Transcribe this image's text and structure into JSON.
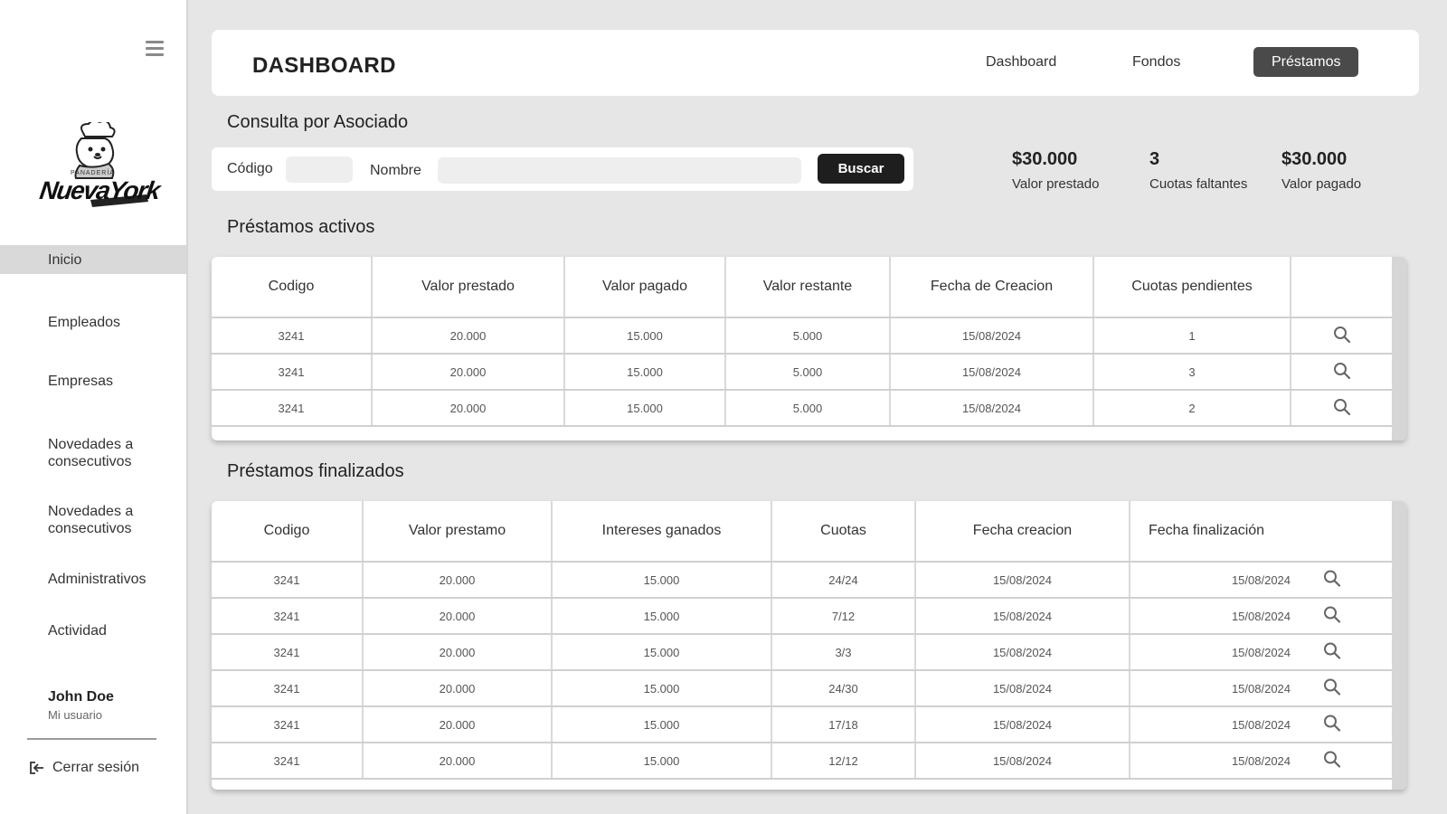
{
  "sidebar": {
    "logo": {
      "brand": "NuevaYork",
      "small": "PANADERÍA"
    },
    "items": [
      {
        "label": "Inicio",
        "active": true
      },
      {
        "label": "Empleados"
      },
      {
        "label": "Empresas"
      },
      {
        "label": "Novedades a consecutivos"
      },
      {
        "label": "Novedades a consecutivos"
      },
      {
        "label": "Administrativos"
      },
      {
        "label": "Actividad"
      }
    ],
    "user": {
      "name": "John Doe",
      "subtitle": "Mi usuario"
    },
    "logout_label": "Cerrar sesión"
  },
  "header": {
    "title": "DASHBOARD",
    "tabs": [
      {
        "label": "Dashboard"
      },
      {
        "label": "Fondos"
      },
      {
        "label": "Préstamos",
        "active": true
      }
    ]
  },
  "search": {
    "title": "Consulta por Asociado",
    "code_label": "Código",
    "code_value": "",
    "name_label": "Nombre",
    "name_value": "",
    "button_label": "Buscar"
  },
  "stats": [
    {
      "value": "$30.000",
      "label": "Valor prestado"
    },
    {
      "value": "3",
      "label": "Cuotas faltantes"
    },
    {
      "value": "$30.000",
      "label": "Valor pagado"
    }
  ],
  "active_loans": {
    "title": "Préstamos activos",
    "columns": [
      "Codigo",
      "Valor prestado",
      "Valor pagado",
      "Valor restante",
      "Fecha de Creacion",
      "Cuotas pendientes",
      ""
    ],
    "rows": [
      [
        "3241",
        "20.000",
        "15.000",
        "5.000",
        "15/08/2024",
        "1"
      ],
      [
        "3241",
        "20.000",
        "15.000",
        "5.000",
        "15/08/2024",
        "3"
      ],
      [
        "3241",
        "20.000",
        "15.000",
        "5.000",
        "15/08/2024",
        "2"
      ]
    ]
  },
  "finished_loans": {
    "title": "Préstamos finalizados",
    "columns": [
      "Codigo",
      "Valor prestamo",
      "Intereses ganados",
      "Cuotas",
      "Fecha creacion",
      "Fecha finalización"
    ],
    "rows": [
      [
        "3241",
        "20.000",
        "15.000",
        "24/24",
        "15/08/2024",
        "15/08/2024"
      ],
      [
        "3241",
        "20.000",
        "15.000",
        "7/12",
        "15/08/2024",
        "15/08/2024"
      ],
      [
        "3241",
        "20.000",
        "15.000",
        "3/3",
        "15/08/2024",
        "15/08/2024"
      ],
      [
        "3241",
        "20.000",
        "15.000",
        "24/30",
        "15/08/2024",
        "15/08/2024"
      ],
      [
        "3241",
        "20.000",
        "15.000",
        "17/18",
        "15/08/2024",
        "15/08/2024"
      ],
      [
        "3241",
        "20.000",
        "15.000",
        "12/12",
        "15/08/2024",
        "15/08/2024"
      ]
    ]
  }
}
